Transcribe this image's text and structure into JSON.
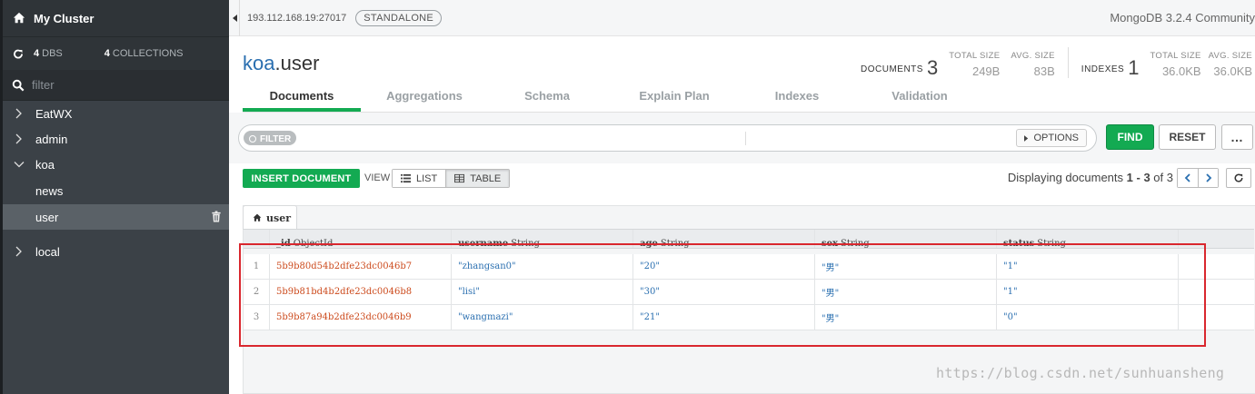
{
  "sidebar": {
    "cluster_name": "My Cluster",
    "dbs_count": "4",
    "dbs_label": "DBS",
    "collections_count": "4",
    "collections_label": "COLLECTIONS",
    "filter_placeholder": "filter",
    "databases": [
      {
        "name": "EatWX",
        "expanded": false
      },
      {
        "name": "admin",
        "expanded": false
      },
      {
        "name": "koa",
        "expanded": true,
        "collections": [
          "news",
          "user"
        ],
        "active_collection": "user"
      },
      {
        "name": "local",
        "expanded": false
      }
    ]
  },
  "topbar": {
    "host": "193.112.168.19:27017",
    "badge": "STANDALONE",
    "version": "MongoDB 3.2.4 Community"
  },
  "collection": {
    "db": "koa",
    "separator": ".",
    "name": "user"
  },
  "stats": {
    "documents_label": "DOCUMENTS",
    "documents_count": "3",
    "total_size_label": "TOTAL SIZE",
    "total_size": "249B",
    "avg_size_label": "AVG. SIZE",
    "avg_size": "83B",
    "indexes_label": "INDEXES",
    "indexes_count": "1",
    "idx_total_size_label": "TOTAL SIZE",
    "idx_total_size": "36.0KB",
    "idx_avg_size_label": "AVG. SIZE",
    "idx_avg_size": "36.0KB"
  },
  "tabs": [
    "Documents",
    "Aggregations",
    "Schema",
    "Explain Plan",
    "Indexes",
    "Validation"
  ],
  "active_tab": "Documents",
  "query": {
    "filter_chip": "FILTER",
    "options_label": "OPTIONS",
    "find_label": "FIND",
    "reset_label": "RESET",
    "more_label": "…"
  },
  "toolbar": {
    "insert_label": "INSERT DOCUMENT",
    "view_label": "VIEW",
    "list_label": "LIST",
    "table_label": "TABLE",
    "display_prefix": "Displaying documents",
    "display_range": "1 - 3",
    "display_of": "of",
    "display_total": "3"
  },
  "table": {
    "tab_label": "user",
    "columns": [
      {
        "field": "_id",
        "type": "ObjectId"
      },
      {
        "field": "username",
        "type": "String"
      },
      {
        "field": "age",
        "type": "String"
      },
      {
        "field": "sex",
        "type": "String"
      },
      {
        "field": "status",
        "type": "String"
      }
    ],
    "rows": [
      {
        "index": "1",
        "cells": [
          "5b9b80d54b2dfe23dc0046b7",
          "\"zhangsan0\"",
          "\"20\"",
          "\"男\"",
          "\"1\""
        ]
      },
      {
        "index": "2",
        "cells": [
          "5b9b81bd4b2dfe23dc0046b8",
          "\"lisi\"",
          "\"30\"",
          "\"男\"",
          "\"1\""
        ]
      },
      {
        "index": "3",
        "cells": [
          "5b9b87a94b2dfe23dc0046b9",
          "\"wangmazi\"",
          "\"21\"",
          "\"男\"",
          "\"0\""
        ]
      }
    ]
  },
  "watermark": "https://blog.csdn.net/sunhuansheng",
  "colors": {
    "accent_green": "#13aa52",
    "sidebar_bg": "#3b4147",
    "objectid": "#cc4a1c",
    "string": "#2a6fb0",
    "highlight": "#d9272e"
  }
}
